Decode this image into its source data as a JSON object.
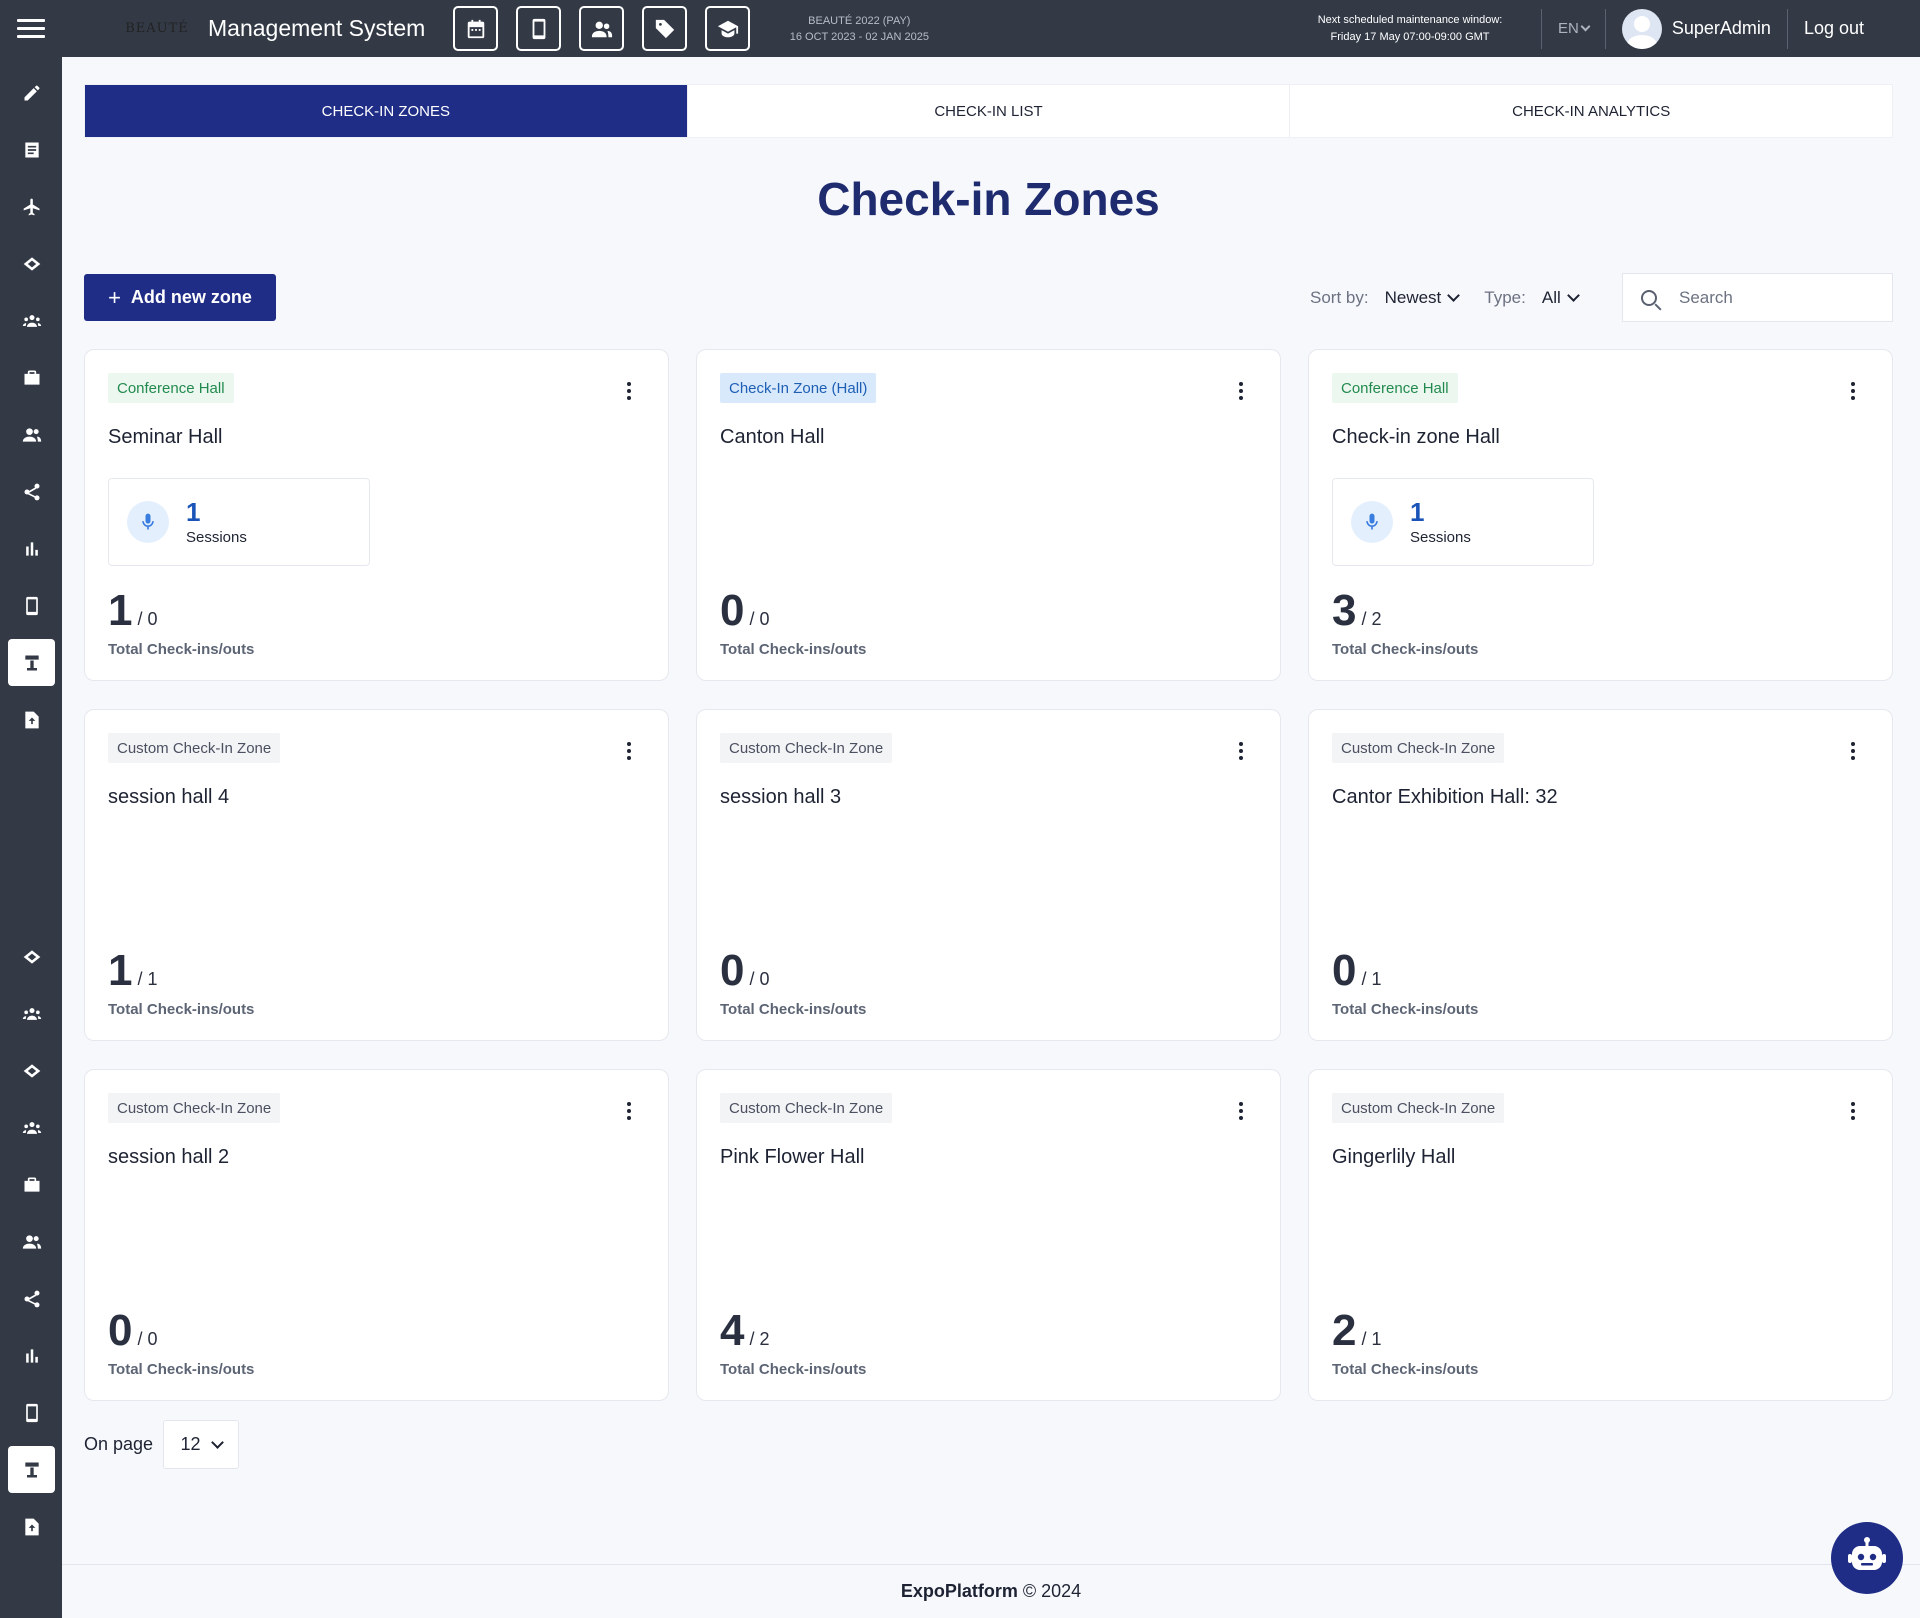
{
  "header": {
    "logo": "BEAUTÉ",
    "logo_sub": "",
    "title": "Management System",
    "quick_actions": [
      {
        "name": "calendar-icon"
      },
      {
        "name": "tablet-icon"
      },
      {
        "name": "people-icon"
      },
      {
        "name": "tag-icon"
      },
      {
        "name": "graduation-cap-icon"
      }
    ],
    "event_name": "BEAUTÉ 2022 (PAY)",
    "event_dates": "16 OCT 2023 - 02 JAN 2025",
    "maintenance_line1": "Next scheduled maintenance window:",
    "maintenance_line2": "Friday 17 May 07:00-09:00 GMT",
    "language": "EN",
    "username": "SuperAdmin",
    "logout": "Log out"
  },
  "sidebar": {
    "items": [
      "pencil-icon",
      "list-icon",
      "plane-icon",
      "handshake-icon",
      "group-icon",
      "briefcase-icon",
      "users-icon",
      "share-icon",
      "bar-chart-icon",
      "mobile-icon",
      "kiosk-icon",
      "upload-file-icon",
      "handshake-icon",
      "group-icon",
      "handshake-icon",
      "group-icon",
      "briefcase-icon",
      "users-icon",
      "share-icon",
      "bar-chart-icon",
      "mobile-icon",
      "kiosk-icon",
      "upload-file-icon"
    ],
    "active": [
      10,
      21
    ]
  },
  "tabs": [
    {
      "label": "CHECK-IN ZONES",
      "active": true
    },
    {
      "label": "CHECK-IN LIST",
      "active": false
    },
    {
      "label": "CHECK-IN ANALYTICS",
      "active": false
    }
  ],
  "page_title": "Check-in Zones",
  "toolbar": {
    "add_label": "Add new zone",
    "sort_label": "Sort by:",
    "sort_value": "Newest",
    "type_label": "Type:",
    "type_value": "All",
    "search_placeholder": "Search"
  },
  "zones": [
    {
      "tag": "Conference Hall",
      "tag_style": "green",
      "name": "Seminar Hall",
      "sessions": "1",
      "sessions_label": "Sessions",
      "count": "1",
      "sub": "/ 0"
    },
    {
      "tag": "Check-In Zone (Hall)",
      "tag_style": "blue",
      "name": "Canton Hall",
      "sessions": null,
      "count": "0",
      "sub": "/ 0"
    },
    {
      "tag": "Conference Hall",
      "tag_style": "green",
      "name": "Check-in zone Hall",
      "sessions": "1",
      "sessions_label": "Sessions",
      "count": "3",
      "sub": "/ 2"
    },
    {
      "tag": "Custom Check-In Zone",
      "tag_style": "gray",
      "name": "session hall 4",
      "sessions": null,
      "count": "1",
      "sub": "/ 1"
    },
    {
      "tag": "Custom Check-In Zone",
      "tag_style": "gray",
      "name": "session hall 3",
      "sessions": null,
      "count": "0",
      "sub": "/ 0"
    },
    {
      "tag": "Custom Check-In Zone",
      "tag_style": "gray",
      "name": "Cantor Exhibition Hall: 32",
      "sessions": null,
      "count": "0",
      "sub": "/ 1"
    },
    {
      "tag": "Custom Check-In Zone",
      "tag_style": "gray",
      "name": "session hall 2",
      "sessions": null,
      "count": "0",
      "sub": "/ 0"
    },
    {
      "tag": "Custom Check-In Zone",
      "tag_style": "gray",
      "name": "Pink Flower Hall",
      "sessions": null,
      "count": "4",
      "sub": "/ 2"
    },
    {
      "tag": "Custom Check-In Zone",
      "tag_style": "gray",
      "name": "Gingerlily Hall",
      "sessions": null,
      "count": "2",
      "sub": "/ 1"
    }
  ],
  "total_label": "Total Check-ins/outs",
  "pagination": {
    "label": "On page",
    "value": "12"
  },
  "footer": {
    "brand": "ExpoPlatform",
    "copyright": "© 2024"
  },
  "colors": {
    "primary": "#1f2d86",
    "topbar": "#333a46",
    "title": "#1f2b6f"
  }
}
